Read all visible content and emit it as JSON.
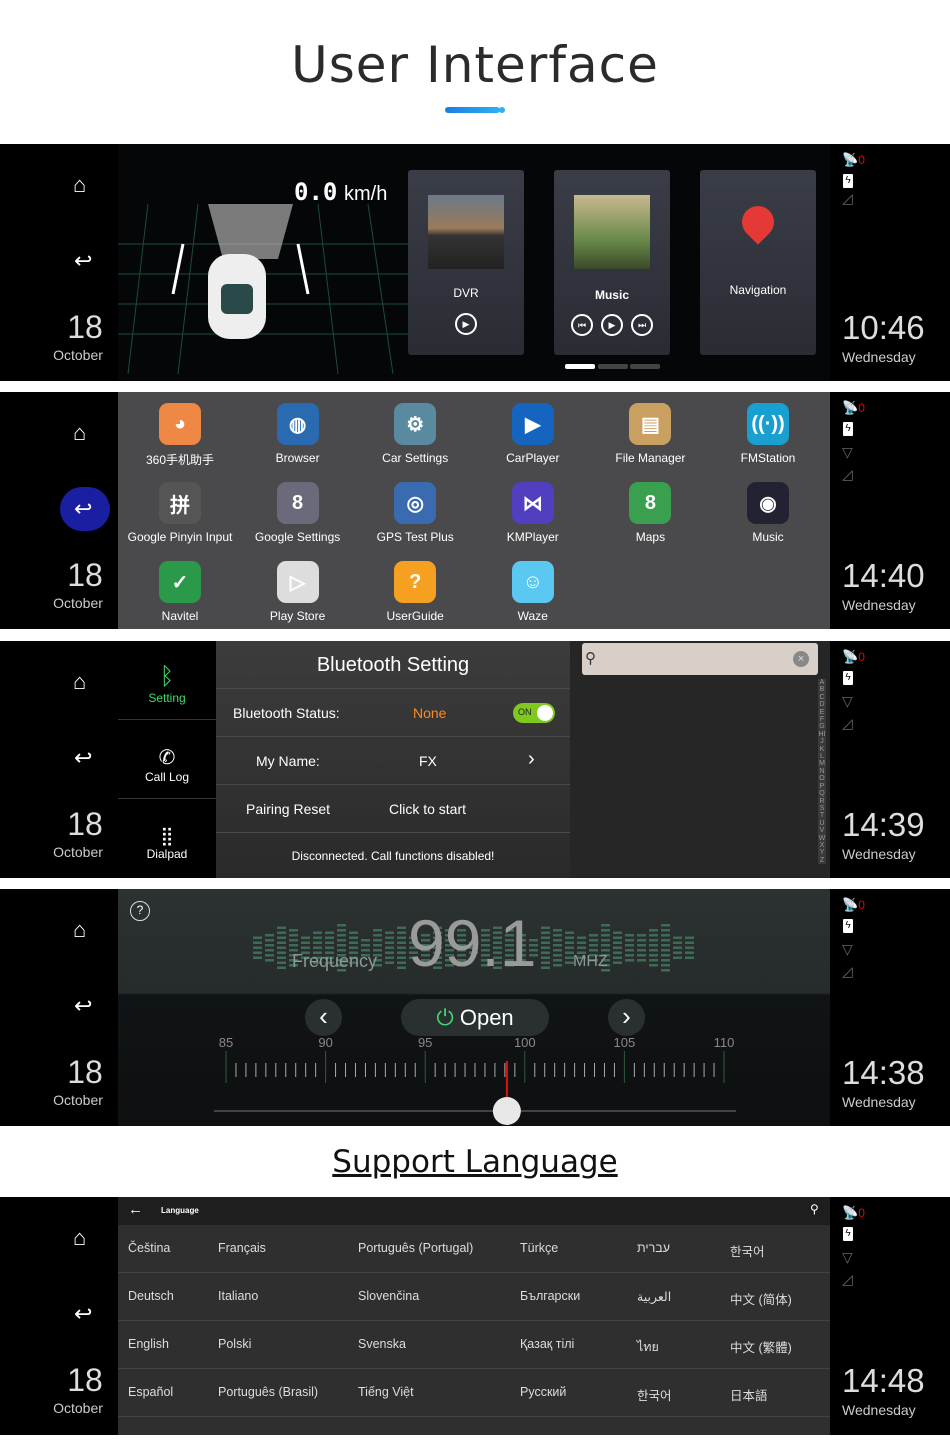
{
  "header": {
    "title": "User Interface",
    "section2": "Support Language"
  },
  "sidebar": {
    "day": "18",
    "month": "October",
    "satellite_count": "0"
  },
  "panels": [
    {
      "time": "10:46",
      "weekday": "Wednesday"
    },
    {
      "time": "14:40",
      "weekday": "Wednesday"
    },
    {
      "time": "14:39",
      "weekday": "Wednesday"
    },
    {
      "time": "14:38",
      "weekday": "Wednesday"
    },
    {
      "time": "14:48",
      "weekday": "Wednesday"
    }
  ],
  "home": {
    "speed": "0.0",
    "unit": "km/h",
    "cards": [
      "DVR",
      "Music",
      "Navigation"
    ],
    "page_count": 3,
    "active_page": 1
  },
  "apps": [
    "360手机助手",
    "Browser",
    "Car Settings",
    "CarPlayer",
    "File Manager",
    "FMStation",
    "Google Pinyin Input",
    "Google Settings",
    "GPS Test Plus",
    "KMPlayer",
    "Maps",
    "Music",
    "Navitel",
    "Play Store",
    "UserGuide",
    "Waze"
  ],
  "bluetooth": {
    "tabs": [
      "Setting",
      "Call Log",
      "Dialpad"
    ],
    "title": "Bluetooth Setting",
    "status_label": "Bluetooth Status:",
    "status_value": "None",
    "toggle": "ON",
    "name_label": "My Name:",
    "name_value": "FX",
    "reset_label": "Pairing Reset",
    "reset_action": "Click to start",
    "message": "Disconnected. Call functions disabled!",
    "alphabet": "ABCDEFGHIJKLMNOPQRSTUVWXYZ"
  },
  "radio": {
    "frequency": "99.1",
    "freq_label": "Frequency",
    "unit": "MHZ",
    "open_label": "Open",
    "scale": [
      "85",
      "90",
      "95",
      "100",
      "105",
      "110"
    ],
    "current": 99.1,
    "min": 85,
    "max": 110
  },
  "language": {
    "title": "Language",
    "rows": [
      [
        "Čeština",
        "Français",
        "Português (Portugal)",
        "Türkçe",
        "עברית",
        "한국어"
      ],
      [
        "Deutsch",
        "Italiano",
        "Slovenčina",
        "Български",
        "العربية",
        "中文 (简体)"
      ],
      [
        "English",
        "Polski",
        "Svenska",
        "Қазақ тілі",
        "ไทย",
        "中文 (繁體)"
      ],
      [
        "Español",
        "Português (Brasil)",
        "Tiếng Việt",
        "Русский",
        "한국어",
        "日本語"
      ]
    ]
  },
  "colors": {
    "accent": "#1a7fe0",
    "nav_pin": "#e53935",
    "status_orange": "#ff8a1e",
    "toggle_green": "#7ec820",
    "power_green": "#3ddc6a",
    "needle": "#e01010"
  }
}
